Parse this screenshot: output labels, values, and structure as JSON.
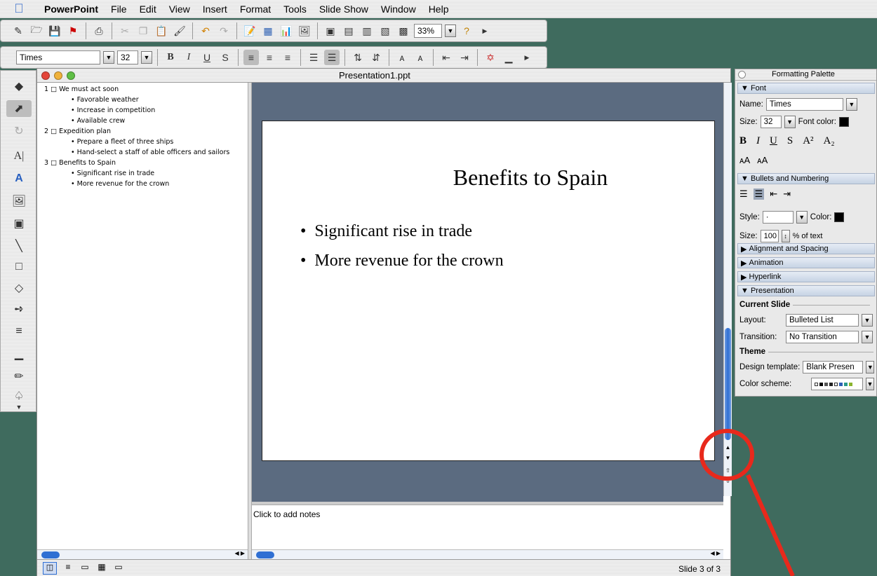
{
  "menubar": {
    "app": "PowerPoint",
    "items": [
      "File",
      "Edit",
      "View",
      "Insert",
      "Format",
      "Tools",
      "Slide Show",
      "Window",
      "Help"
    ]
  },
  "standard_toolbar": {
    "zoom": "33%"
  },
  "formatting_toolbar": {
    "font_name": "Times",
    "font_size": "32"
  },
  "window": {
    "title": "Presentation1.ppt"
  },
  "outline": {
    "slides": [
      {
        "num": "1",
        "title": "We must act soon",
        "bullets": [
          "Favorable weather",
          "Increase in competition",
          "Available crew"
        ]
      },
      {
        "num": "2",
        "title": "Expedition plan",
        "bullets": [
          "Prepare a fleet of three ships",
          "Hand-select a staff of able officers and sailors"
        ]
      },
      {
        "num": "3",
        "title": "Benefits to Spain",
        "bullets": [
          "Significant rise in trade",
          "More revenue for the crown"
        ]
      }
    ]
  },
  "slide": {
    "title": "Benefits to Spain",
    "bullets": [
      "Significant rise in trade",
      "More revenue for the crown"
    ]
  },
  "notes": {
    "placeholder": "Click to add notes"
  },
  "status": {
    "slide_count": "Slide 3 of 3"
  },
  "palette": {
    "title": "Formatting Palette",
    "font_section": "Font",
    "name_label": "Name:",
    "name_value": "Times",
    "size_label": "Size:",
    "size_value": "32",
    "font_color_label": "Font color:",
    "bullets_section": "Bullets and Numbering",
    "style_label": "Style:",
    "style_value": "·",
    "color_label": "Color:",
    "bsize_label": "Size:",
    "bsize_value": "100",
    "bsize_suffix": "% of text",
    "alignment_section": "Alignment and Spacing",
    "animation_section": "Animation",
    "hyperlink_section": "Hyperlink",
    "presentation_section": "Presentation",
    "current_slide_label": "Current Slide",
    "layout_label": "Layout:",
    "layout_value": "Bulleted List",
    "transition_label": "Transition:",
    "transition_value": "No Transition",
    "theme_label": "Theme",
    "design_label": "Design template:",
    "design_value": "Blank Presen",
    "scheme_label": "Color scheme:"
  },
  "colors": {
    "desktop": "#3f6b5e",
    "annotation": "#e8291c",
    "slide_bg": "#5b6b80"
  }
}
